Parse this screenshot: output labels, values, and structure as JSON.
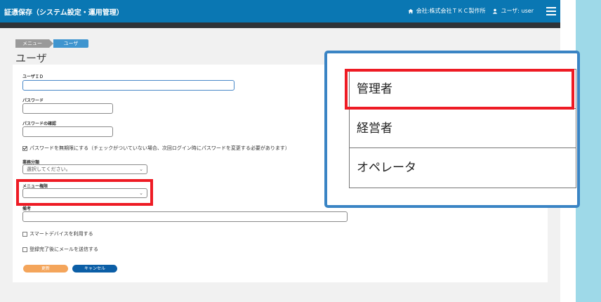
{
  "header": {
    "app_title": "証憑保存（システム設定・運用管理）",
    "company": "会社:株式会社ＴＫＣ製作所",
    "user": "ユーザ: user"
  },
  "breadcrumb": [
    "メニュー",
    "ユーザ"
  ],
  "page_title": "ユーザ",
  "form": {
    "user_id_label": "ユーザＩＤ",
    "user_id_value": "",
    "password_label": "パスワード",
    "password_value": "",
    "password_confirm_label": "パスワードの確認",
    "password_confirm_value": "",
    "no_expire_label": "パスワードを無期限にする（チェックがついていない場合、次回ログイン時にパスワードを変更する必要があります）",
    "no_expire_checked": true,
    "business_type_label": "業務分類",
    "business_type_value": "選択してください。",
    "menu_permission_label": "メニュー権限",
    "menu_permission_value": "",
    "note_label": "備考",
    "note_value": "",
    "smart_device_label": "スマートデバイスを利用する",
    "smart_device_checked": false,
    "send_mail_label": "登録完了後にメールを送信する",
    "send_mail_checked": false,
    "update_button": "更新",
    "cancel_button": "キャンセル"
  },
  "menu_permission_options": [
    "管理者",
    "経営者",
    "オペレータ"
  ],
  "colors": {
    "topbar": "#0a77b3",
    "highlight_red": "#ee1b24",
    "callout_border": "#3a84c4",
    "update_button": "#f4a55b",
    "cancel_button": "#0b5ea6"
  }
}
